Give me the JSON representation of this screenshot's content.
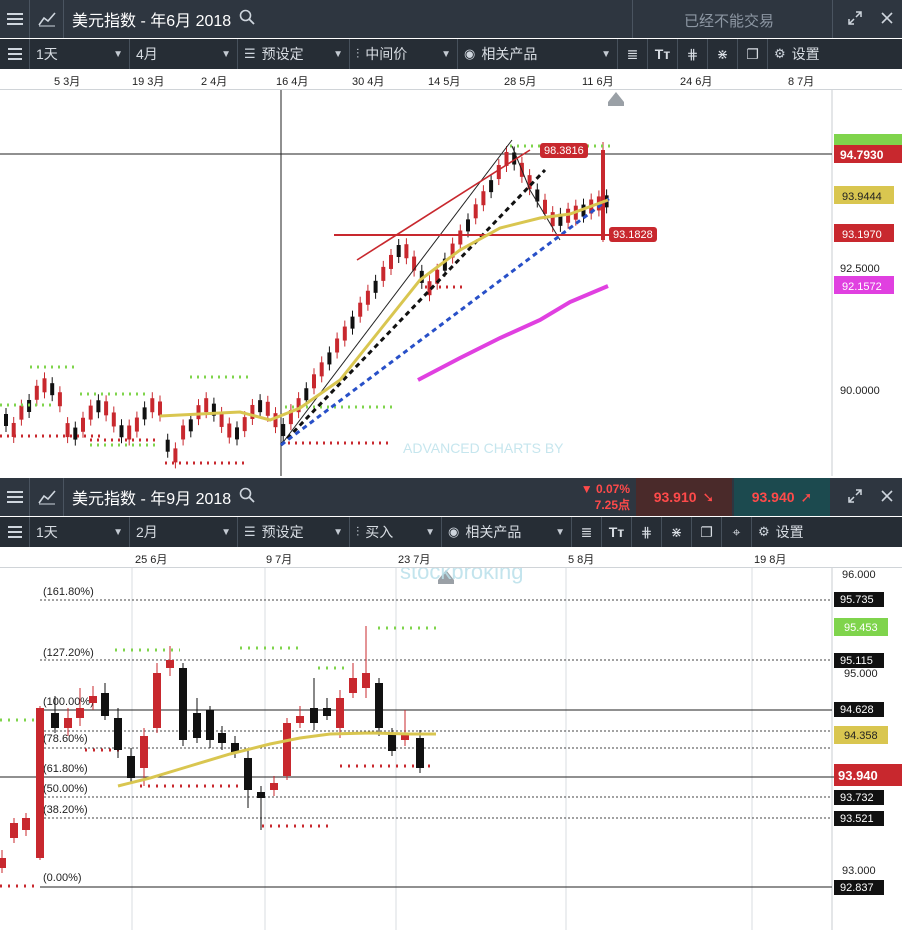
{
  "colors": {
    "panel_dark": "#2e3640",
    "toolbar_dark": "#262d35",
    "bull_red": "#c8282e",
    "bear_black": "#111111",
    "ma_yellow": "#d9c650",
    "support_green": "#7fd44c",
    "resistance_red": "#c8282e",
    "long_ma_magenta": "#e040e0",
    "trend_blue": "#2850c8",
    "sell_box": "#4a2a2a",
    "buy_box": "#1c4a4f"
  },
  "icons": {
    "menu": "hamburger-icon",
    "chart_type": "line-chart-icon",
    "search": "magnifier-icon",
    "restore": "restore-window-icon",
    "close": "close-icon",
    "templates": "sliders-icon",
    "price_type": "candles-icon",
    "related": "eye-icon",
    "settings": "gear-icon"
  },
  "top_panel": {
    "title": "美元指数 - 年6月 2018",
    "status": "已经不能交易",
    "toolbar": {
      "interval": "1天",
      "range": "4月",
      "template": "预设定",
      "price_type": "中间价",
      "related": "相关产品",
      "settings": "设置"
    },
    "dates": [
      "5 3月",
      "19 3月",
      "2 4月",
      "16 4月",
      "30 4月",
      "14 5月",
      "28 5月",
      "11 6月",
      "24 6月",
      "8 7月"
    ],
    "price_labels": {
      "last": "94.7930",
      "ma": "93.9444",
      "support": "93.1970",
      "level_92": "92.5000",
      "long_ma": "92.1572",
      "level_90": "90.0000",
      "high_marker": "98.3816",
      "low_marker": "93.1828"
    }
  },
  "watermark": {
    "line1": "ADVANCED CHARTS BY",
    "line2": "stockbroking"
  },
  "bottom_panel": {
    "title": "美元指数 - 年9月 2018",
    "change_pct": "▼ 0.07%",
    "change_pts": "7.25点",
    "sell": "93.910",
    "buy": "93.940",
    "toolbar": {
      "interval": "1天",
      "range": "2月",
      "template": "预设定",
      "trade": "买入",
      "related": "相关产品",
      "settings": "设置"
    },
    "dates": [
      "25 6月",
      "9 7月",
      "23 7月",
      "5 8月",
      "19 8月"
    ],
    "fib_levels": [
      "(161.80%)",
      "(127.20%)",
      "(100.00%)",
      "(78.60%)",
      "(61.80%)",
      "(50.00%)",
      "(38.20%)",
      "(0.00%)"
    ],
    "price_labels": {
      "p96": "96.000",
      "fib1618": "95.735",
      "green": "95.453",
      "fib1272": "95.115",
      "p95": "95.000",
      "fib100": "94.628",
      "ma": "94.358",
      "last": "93.940",
      "fib50": "93.732",
      "fib382": "93.521",
      "p93": "93.000",
      "fib0": "92.837"
    }
  }
}
